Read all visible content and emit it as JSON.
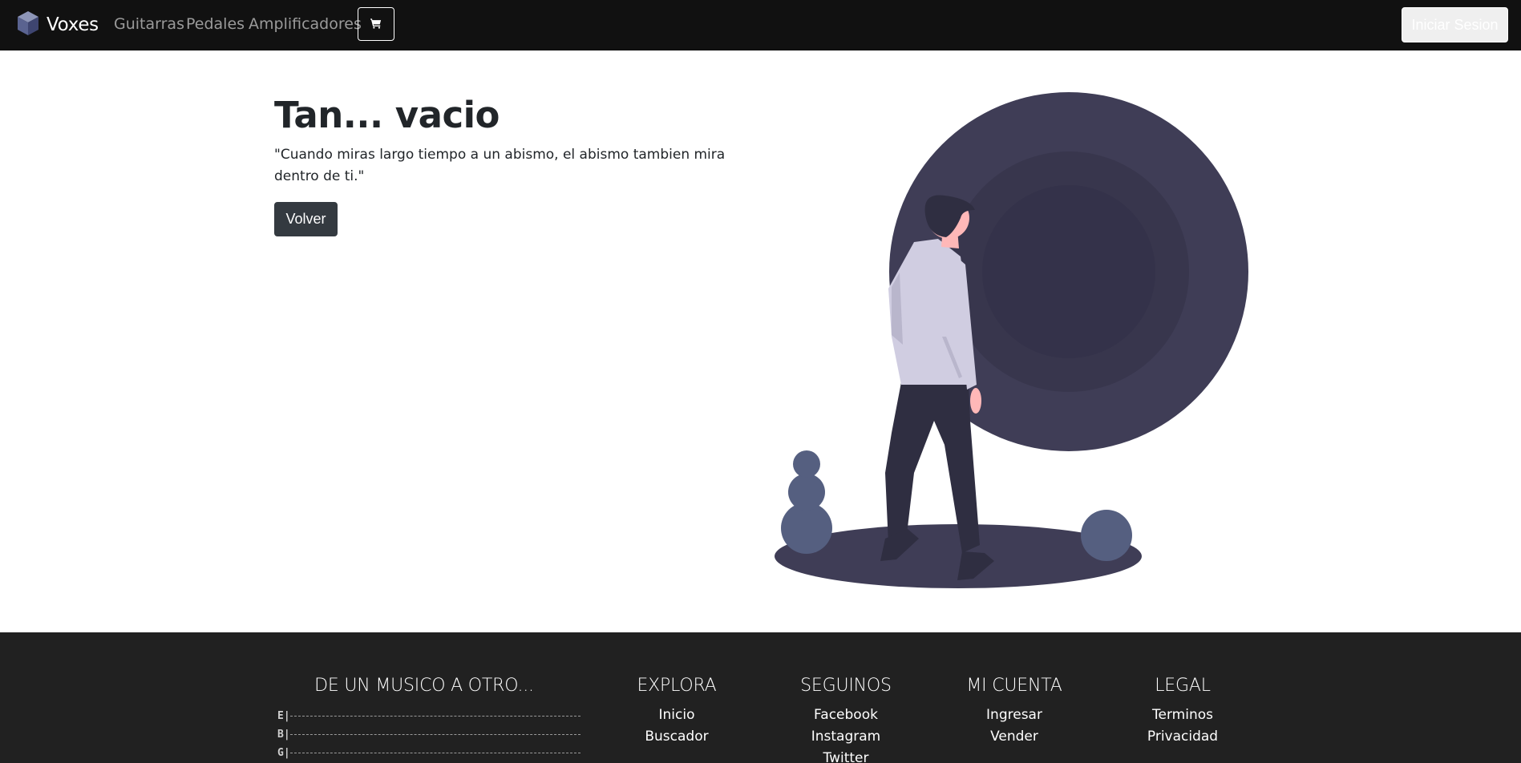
{
  "navbar": {
    "brand": "Voxes",
    "links": [
      "Guitarras",
      "Pedales",
      "Amplificadores"
    ],
    "cart_icon": "cart-icon",
    "login_label": "Iniciar Sesion"
  },
  "hero": {
    "title": "Tan... vacio",
    "quote": "\"Cuando miras largo tiempo a un abismo, el abismo tambien mira dentro de ti.\"",
    "button_label": "Volver"
  },
  "footer": {
    "tagline": "DE UN MUSICO A OTRO...",
    "tab_strings": [
      "E|",
      "B|",
      "G|"
    ],
    "columns": [
      {
        "title": "EXPLORA",
        "links": [
          "Inicio",
          "Buscador"
        ]
      },
      {
        "title": "SEGUINOS",
        "links": [
          "Facebook",
          "Instagram",
          "Twitter"
        ]
      },
      {
        "title": "MI CUENTA",
        "links": [
          "Ingresar",
          "Vender"
        ]
      },
      {
        "title": "LEGAL",
        "links": [
          "Terminos",
          "Privacidad"
        ]
      }
    ]
  },
  "colors": {
    "navbar_bg": "#111111",
    "footer_bg": "#212121",
    "button_dark": "#343a40",
    "illustration_dark": "#3f3d56",
    "illustration_accent": "#555f80"
  }
}
